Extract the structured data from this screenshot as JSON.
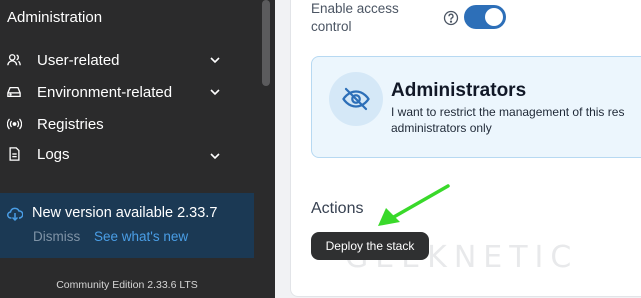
{
  "sidebar": {
    "heading": "Administration",
    "items": [
      {
        "label": "User-related",
        "icon": "users-icon",
        "has_chevron": true
      },
      {
        "label": "Environment-related",
        "icon": "drive-icon",
        "has_chevron": true
      },
      {
        "label": "Registries",
        "icon": "broadcast-icon",
        "has_chevron": false
      },
      {
        "label": "Logs",
        "icon": "document-icon",
        "has_chevron": true
      }
    ],
    "update": {
      "title": "New version available 2.33.7",
      "dismiss": "Dismiss",
      "whats_new": "See what's new",
      "icon": "cloud-download-icon"
    },
    "edition": "Community Edition  2.33.6 LTS"
  },
  "main": {
    "access_control_label": "Enable access control",
    "access_control_enabled": true,
    "admin_option": {
      "title": "Administrators",
      "description_line1": "I want to restrict the management of this res",
      "description_line2": "administrators only",
      "icon": "eye-off-icon"
    },
    "actions_heading": "Actions",
    "deploy_tooltip": "Deploy the stack"
  },
  "watermark": "GEEKNETIC",
  "colors": {
    "sidebar_bg": "#2b2b2c",
    "update_bg": "#1b3954",
    "link_blue": "#4a9ee6",
    "toggle_on": "#2d6fb8",
    "admin_box_bg": "#ecf6fd",
    "annotation_arrow": "#39d92a"
  }
}
